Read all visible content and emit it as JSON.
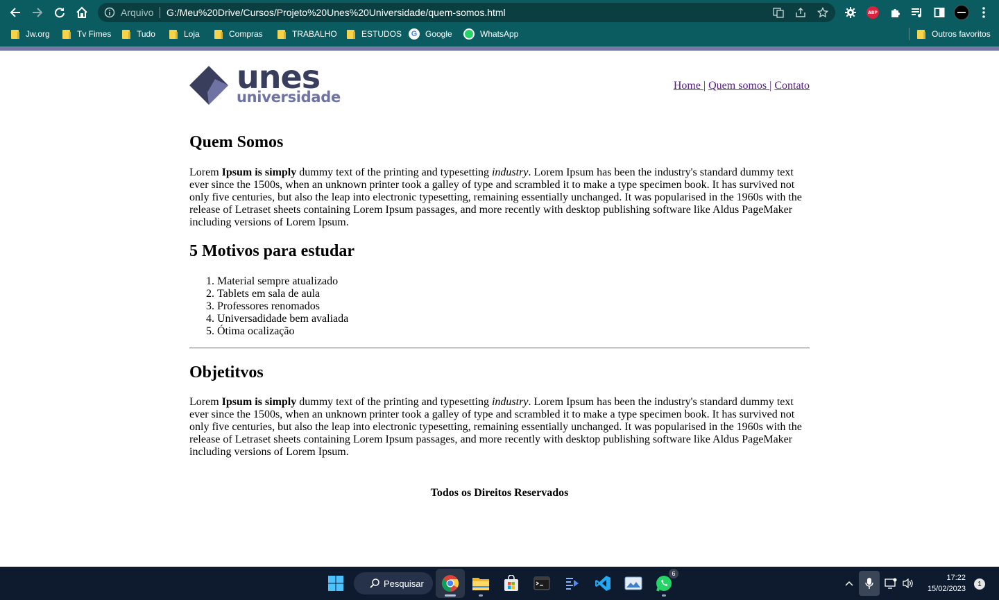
{
  "browser": {
    "scheme_label": "Arquivo",
    "url": "G:/Meu%20Drive/Cursos/Projeto%20Unes%20Universidade/quem-somos.html",
    "icons": [
      "back-arrow-icon",
      "forward-arrow-icon",
      "reload-icon",
      "home-icon",
      "info-icon",
      "translate-icon",
      "share-icon",
      "star-icon",
      "settings-gear-icon",
      "adblock-plus-icon",
      "extensions-puzzle-icon",
      "media-queue-icon",
      "side-panel-icon",
      "profile-avatar-icon",
      "more-vert-icon"
    ],
    "abp_label": "ABP",
    "bookmarks": [
      {
        "label": "Jw.org",
        "icon": "folder-icon"
      },
      {
        "label": "Tv Fimes",
        "icon": "folder-icon"
      },
      {
        "label": "Tudo",
        "icon": "folder-icon"
      },
      {
        "label": "Loja",
        "icon": "folder-icon"
      },
      {
        "label": "Compras",
        "icon": "folder-icon"
      },
      {
        "label": "TRABALHO",
        "icon": "folder-icon"
      },
      {
        "label": "ESTUDOS",
        "icon": "folder-icon"
      },
      {
        "label": "Google",
        "icon": "google-icon"
      },
      {
        "label": "WhatsApp",
        "icon": "whatsapp-icon"
      }
    ],
    "other_bookmarks": "Outros favoritos",
    "google_glyph": "G"
  },
  "colors": {
    "chrome_bg": "#0b5c60",
    "accent_bar": "#7578a5",
    "logo_dark": "#393e5d",
    "logo_light": "#6f73a4",
    "visited_link": "#551a8b",
    "taskbar_bg": "#0e1b2e"
  },
  "site": {
    "logo": {
      "line1": "unes",
      "line2": "universidade"
    },
    "nav": {
      "home": "Home ",
      "about": "Quem somos ",
      "contact": "Contato",
      "separator": "|"
    }
  },
  "content": {
    "heading1": "Quem Somos",
    "paragraph": {
      "t1": "Lorem ",
      "b1": "Ipsum is simply",
      "t2": " dummy text of the printing and typesetting ",
      "i1": "industry",
      "t3": ". Lorem Ipsum has been the industry's standard dummy text ever since the 1500s, when an unknown printer took a galley of type and scrambled it to make a type specimen book. It has survived not only five centuries, but also the leap into electronic typesetting, remaining essentially unchanged. It was popularised in the 1960s with the release of Letraset sheets containing Lorem Ipsum passages, and more recently with desktop publishing software like Aldus PageMaker including versions of Lorem Ipsum."
    },
    "heading2": "5 Motivos para estudar",
    "reasons": [
      "Material sempre atualizado",
      "Tablets em sala de aula",
      "Professores renomados",
      "Universadidade bem avaliada",
      "Ótima ocalização"
    ],
    "heading3": "Objetitvos",
    "footer": "Todos os Direitos Reservados"
  },
  "taskbar": {
    "search_label": "Pesquisar",
    "whatsapp_badge": "6",
    "time": "17:22",
    "date": "15/02/2023",
    "notification_count": "1",
    "apps": [
      "windows-start-icon",
      "chrome-icon",
      "file-explorer-icon",
      "microsoft-store-icon",
      "terminal-icon",
      "dev-tool-icon",
      "vscode-icon",
      "photos-icon",
      "whatsapp-icon"
    ]
  }
}
